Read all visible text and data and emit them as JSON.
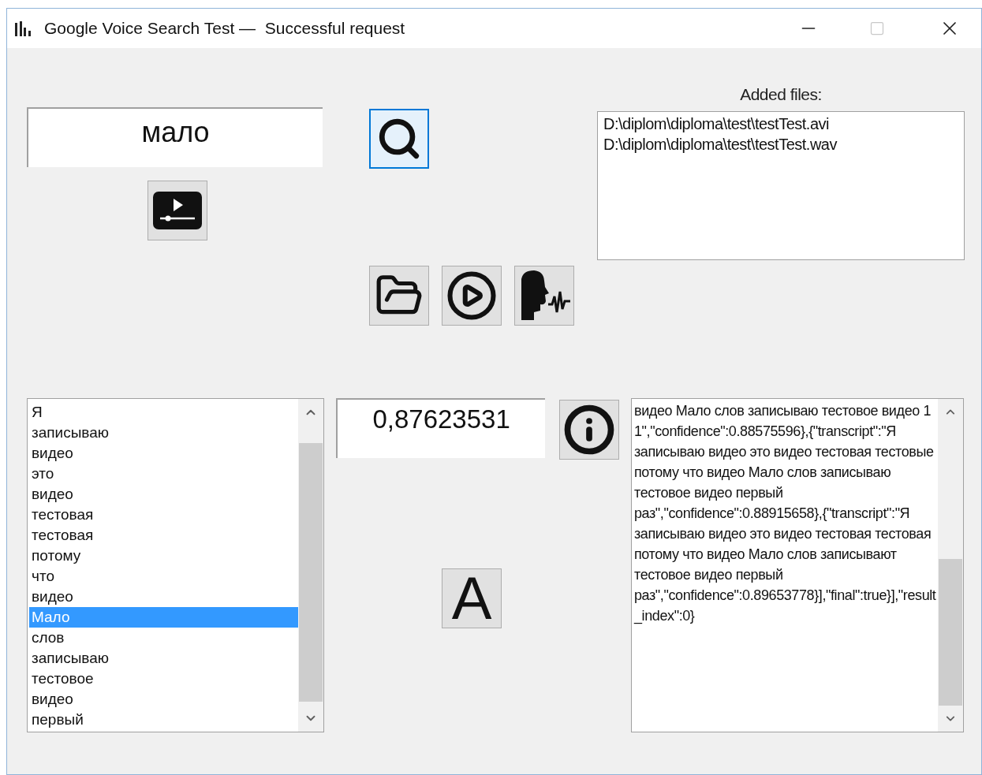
{
  "window": {
    "title": "Google Voice Search Test —  Successful request"
  },
  "word_field": {
    "value": "мало"
  },
  "search_button": {
    "focused": true
  },
  "files": {
    "label": "Added files:",
    "items": [
      "D:\\diplom\\diploma\\test\\testTest.avi",
      "D:\\diplom\\diploma\\test\\testTest.wav"
    ]
  },
  "words": [
    {
      "text": "Я",
      "selected": false
    },
    {
      "text": "записываю",
      "selected": false
    },
    {
      "text": "видео",
      "selected": false
    },
    {
      "text": "это",
      "selected": false
    },
    {
      "text": "видео",
      "selected": false
    },
    {
      "text": "тестовая",
      "selected": false
    },
    {
      "text": "тестовая",
      "selected": false
    },
    {
      "text": "потому",
      "selected": false
    },
    {
      "text": "что",
      "selected": false
    },
    {
      "text": "видео",
      "selected": false
    },
    {
      "text": "Мало",
      "selected": true
    },
    {
      "text": "слов",
      "selected": false
    },
    {
      "text": "записываю",
      "selected": false
    },
    {
      "text": "тестовое",
      "selected": false
    },
    {
      "text": "видео",
      "selected": false
    },
    {
      "text": "первый",
      "selected": false
    }
  ],
  "confidence_field": {
    "value": "0,87623531"
  },
  "font_button": {
    "label": "A"
  },
  "response_text": {
    "value": "видео Мало слов записываю тестовое видео 1 1\",\"confidence\":0.88575596},{\"transcript\":\"Я записываю видео это видео тестовая тестовые потому что видео Мало слов записываю тестовое видео первый раз\",\"confidence\":0.88915658},{\"transcript\":\"Я записываю видео это видео тестовая тестовая потому что видео Мало слов записывают тестовое видео первый раз\",\"confidence\":0.89653778}],\"final\":true}],\"result_index\":0}"
  }
}
